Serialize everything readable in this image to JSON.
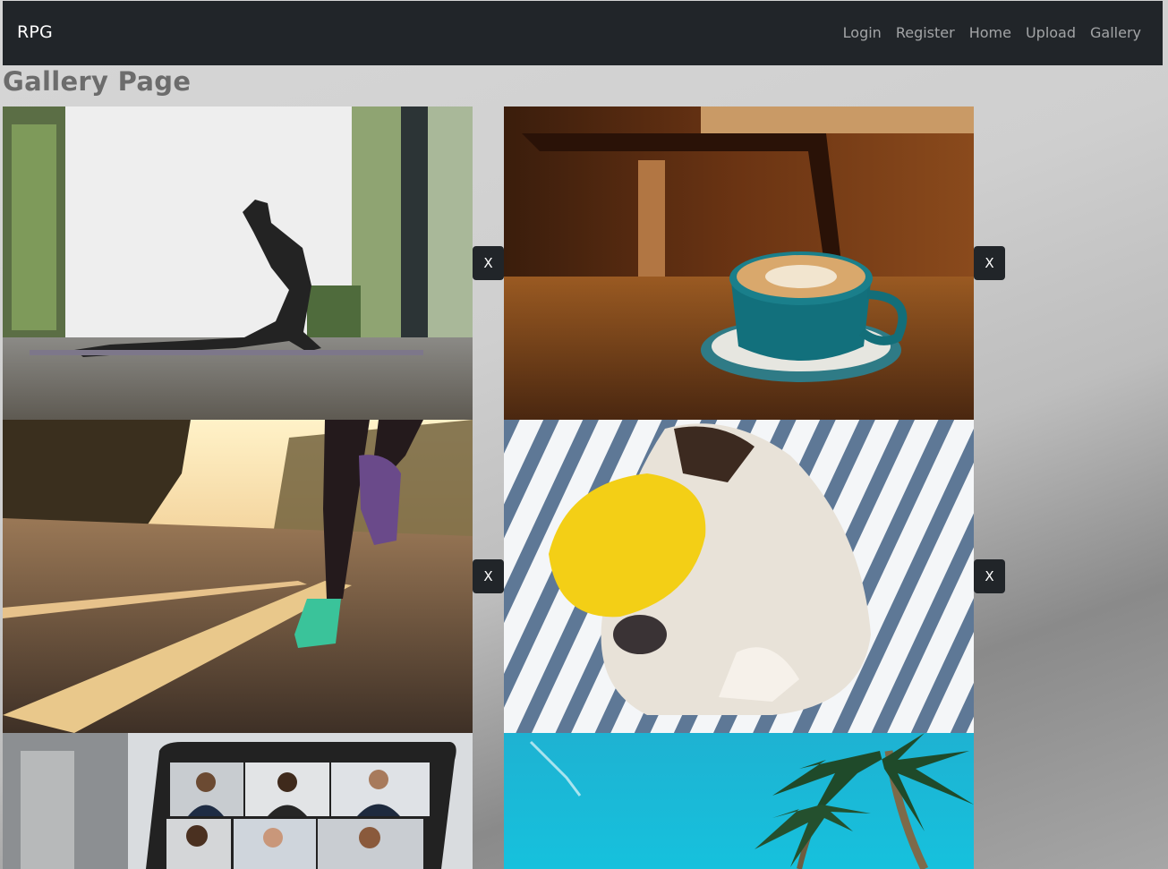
{
  "navbar": {
    "brand": "RPG",
    "links": [
      {
        "label": "Login"
      },
      {
        "label": "Register"
      },
      {
        "label": "Home"
      },
      {
        "label": "Upload"
      },
      {
        "label": "Gallery"
      }
    ]
  },
  "page": {
    "title": "Gallery Page"
  },
  "gallery": {
    "delete_label": "X",
    "images": [
      {
        "subject": "woman doing yoga cobra pose by a window"
      },
      {
        "subject": "latte art in a teal cup on a wooden table"
      },
      {
        "subject": "runner's legs on an asphalt road at sunset"
      },
      {
        "subject": "dog sleeping with a yellow eye mask under striped sheets"
      },
      {
        "subject": "laptop showing a video conference grid"
      },
      {
        "subject": "palm trees against a bright blue sky"
      }
    ]
  }
}
